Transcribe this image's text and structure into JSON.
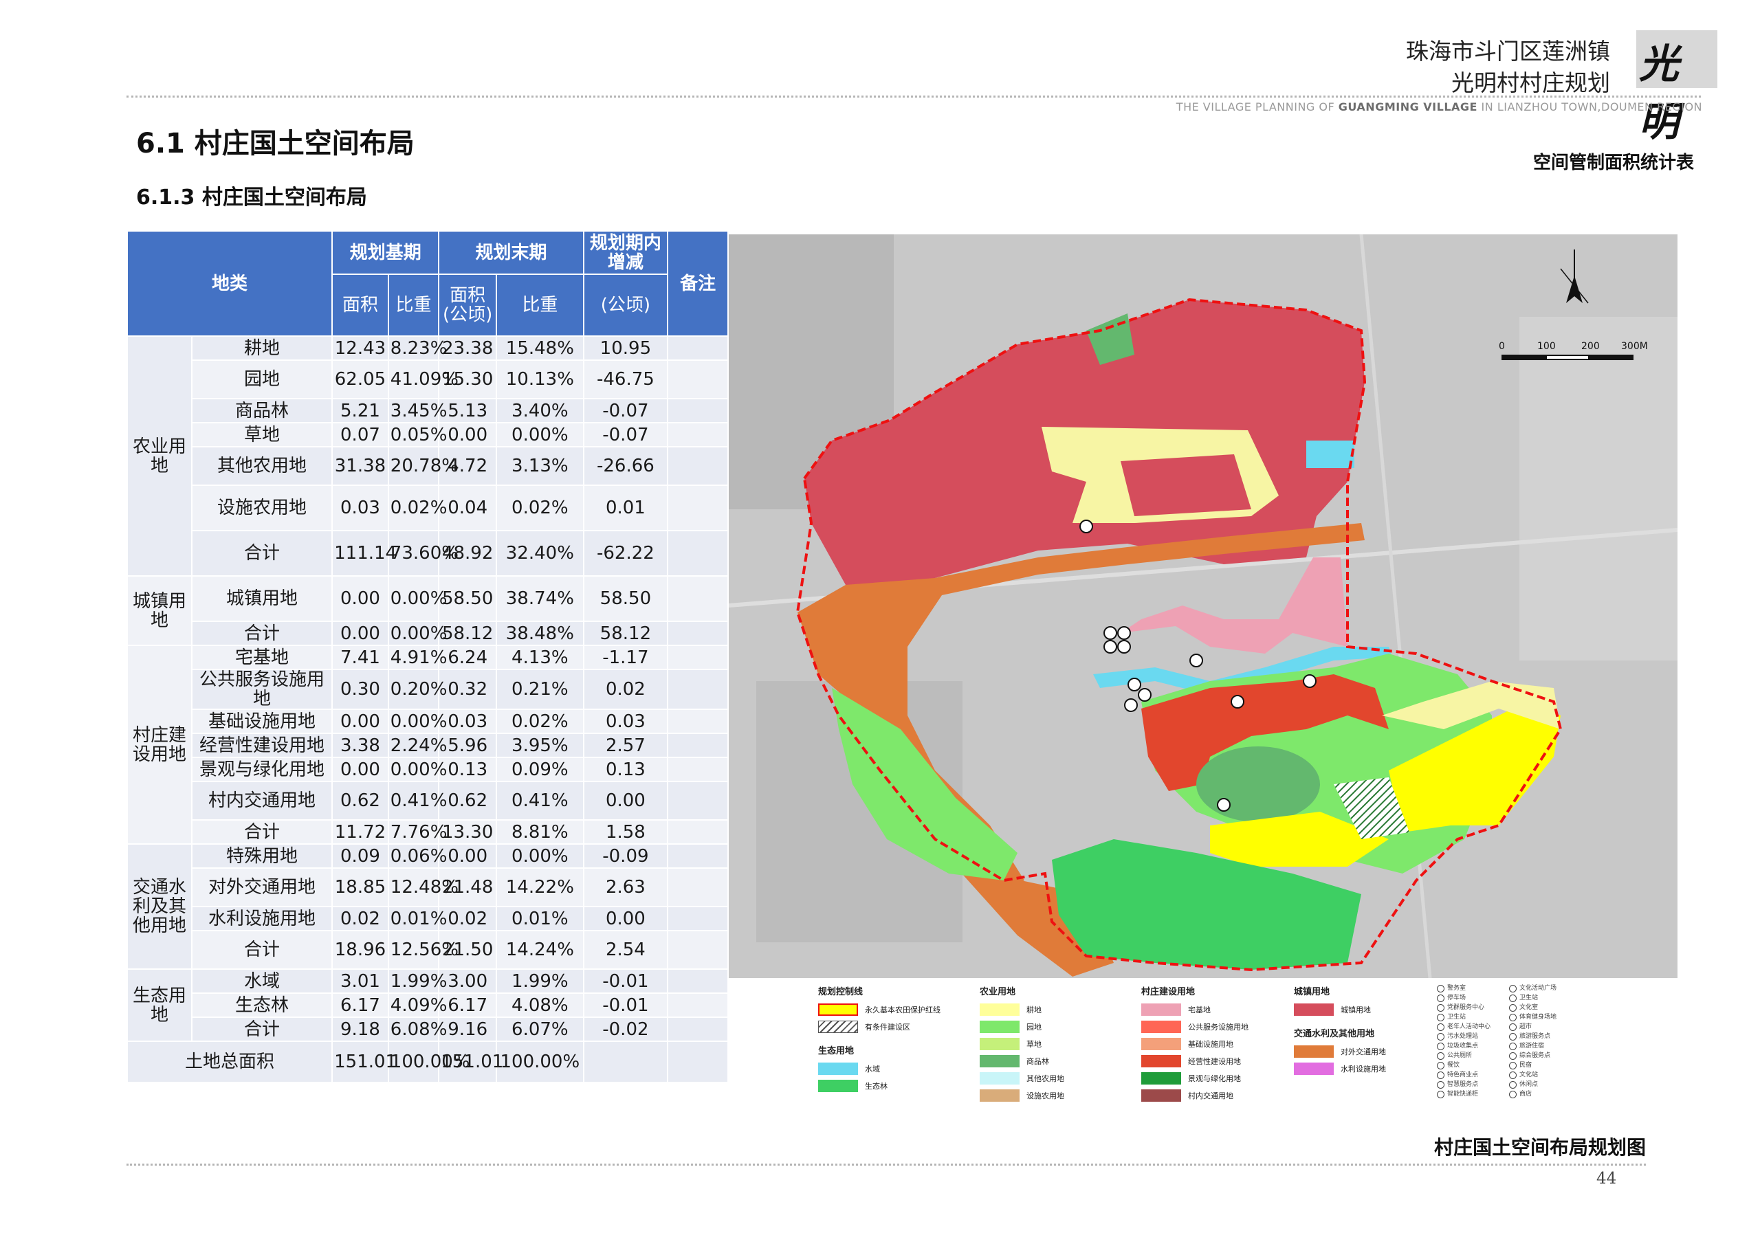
{
  "header": {
    "project_line1": "珠海市斗门区莲洲镇",
    "project_line2": "光明村村庄规划",
    "logo_text": "光明",
    "subtitle_pre": "THE VILLAGE PLANNING OF ",
    "subtitle_bold": "GUANGMING VILLAGE",
    "subtitle_post": " IN LIANZHOU TOWN,DOUMEN REGION"
  },
  "section_title": "6.1 村庄国土空间布局",
  "subsection_title": "6.1.3 村庄国土空间布局",
  "table_caption": "空间管制面积统计表",
  "map_caption": "村庄国土空间布局规划图",
  "page_number": "44",
  "table": {
    "headers": {
      "land_type": "地类",
      "base_period": "规划基期",
      "end_period": "规划末期",
      "change": "规划期内增减",
      "note": "备注",
      "area": "面积",
      "ratio": "比重",
      "area_ha": "面积(公顷)",
      "ratio2": "比重",
      "change_unit": "(公顷)"
    },
    "groups": {
      "agri": "农业用地",
      "urban": "城镇用地",
      "village": "村庄建设用地",
      "transport": "交通水利及其他用地",
      "eco": "生态用地"
    },
    "rows": [
      {
        "sub": "耕地",
        "a1": "12.43",
        "r1": "8.23%",
        "a2": "23.38",
        "r2": "15.48%",
        "d": "10.95"
      },
      {
        "sub": "园地",
        "a1": "62.05",
        "r1": "41.09%",
        "a2": "15.30",
        "r2": "10.13%",
        "d": "-46.75"
      },
      {
        "sub": "商品林",
        "a1": "5.21",
        "r1": "3.45%",
        "a2": "5.13",
        "r2": "3.40%",
        "d": "-0.07"
      },
      {
        "sub": "草地",
        "a1": "0.07",
        "r1": "0.05%",
        "a2": "0.00",
        "r2": "0.00%",
        "d": "-0.07"
      },
      {
        "sub": "其他农用地",
        "a1": "31.38",
        "r1": "20.78%",
        "a2": "4.72",
        "r2": "3.13%",
        "d": "-26.66"
      },
      {
        "sub": "设施农用地",
        "a1": "0.03",
        "r1": "0.02%",
        "a2": "0.04",
        "r2": "0.02%",
        "d": "0.01"
      },
      {
        "sub": "合计",
        "a1": "111.14",
        "r1": "73.60%",
        "a2": "48.92",
        "r2": "32.40%",
        "d": "-62.22"
      },
      {
        "sub": "城镇用地",
        "a1": "0.00",
        "r1": "0.00%",
        "a2": "58.50",
        "r2": "38.74%",
        "d": "58.50"
      },
      {
        "sub": "合计",
        "a1": "0.00",
        "r1": "0.00%",
        "a2": "58.12",
        "r2": "38.48%",
        "d": "58.12"
      },
      {
        "sub": "宅基地",
        "a1": "7.41",
        "r1": "4.91%",
        "a2": "6.24",
        "r2": "4.13%",
        "d": "-1.17"
      },
      {
        "sub": "公共服务设施用地",
        "a1": "0.30",
        "r1": "0.20%",
        "a2": "0.32",
        "r2": "0.21%",
        "d": "0.02"
      },
      {
        "sub": "基础设施用地",
        "a1": "0.00",
        "r1": "0.00%",
        "a2": "0.03",
        "r2": "0.02%",
        "d": "0.03"
      },
      {
        "sub": "经营性建设用地",
        "a1": "3.38",
        "r1": "2.24%",
        "a2": "5.96",
        "r2": "3.95%",
        "d": "2.57"
      },
      {
        "sub": "景观与绿化用地",
        "a1": "0.00",
        "r1": "0.00%",
        "a2": "0.13",
        "r2": "0.09%",
        "d": "0.13"
      },
      {
        "sub": "村内交通用地",
        "a1": "0.62",
        "r1": "0.41%",
        "a2": "0.62",
        "r2": "0.41%",
        "d": "0.00"
      },
      {
        "sub": "合计",
        "a1": "11.72",
        "r1": "7.76%",
        "a2": "13.30",
        "r2": "8.81%",
        "d": "1.58"
      },
      {
        "sub": "特殊用地",
        "a1": "0.09",
        "r1": "0.06%",
        "a2": "0.00",
        "r2": "0.00%",
        "d": "-0.09"
      },
      {
        "sub": "对外交通用地",
        "a1": "18.85",
        "r1": "12.48%",
        "a2": "21.48",
        "r2": "14.22%",
        "d": "2.63"
      },
      {
        "sub": "水利设施用地",
        "a1": "0.02",
        "r1": "0.01%",
        "a2": "0.02",
        "r2": "0.01%",
        "d": "0.00"
      },
      {
        "sub": "合计",
        "a1": "18.96",
        "r1": "12.56%",
        "a2": "21.50",
        "r2": "14.24%",
        "d": "2.54"
      },
      {
        "sub": "水域",
        "a1": "3.01",
        "r1": "1.99%",
        "a2": "3.00",
        "r2": "1.99%",
        "d": "-0.01"
      },
      {
        "sub": "生态林",
        "a1": "6.17",
        "r1": "4.09%",
        "a2": "6.17",
        "r2": "4.08%",
        "d": "-0.01"
      },
      {
        "sub": "合计",
        "a1": "9.18",
        "r1": "6.08%",
        "a2": "9.16",
        "r2": "6.07%",
        "d": "-0.02"
      }
    ],
    "total": {
      "label": "土地总面积",
      "a1": "151.01",
      "r1": "100.00%",
      "a2": "151.01",
      "r2": "100.00%"
    }
  },
  "map": {
    "scale_labels": [
      "0",
      "100",
      "200",
      "300M"
    ],
    "legend": {
      "control_head": "规划控制线",
      "control_items": [
        "永久基本农田保护红线",
        "有条件建设区"
      ],
      "eco_head": "生态用地",
      "eco_items": [
        "水域",
        "生态林"
      ],
      "agri_head": "农业用地",
      "agri_items": [
        "耕地",
        "园地",
        "草地",
        "商品林",
        "其他农用地",
        "设施农用地"
      ],
      "village_head": "村庄建设用地",
      "village_items": [
        "宅基地",
        "公共服务设施用地",
        "基础设施用地",
        "经营性建设用地",
        "景观与绿化用地",
        "村内交通用地"
      ],
      "urban_head": "城镇用地",
      "urban_items": [
        "城镇用地"
      ],
      "transport_head": "交通水利及其他用地",
      "transport_items": [
        "对外交通用地",
        "水利设施用地"
      ],
      "symbols_a": [
        "警务室",
        "停车场",
        "党群服务中心",
        "卫生站",
        "老年人活动中心",
        "污水处理站",
        "垃圾收集点",
        "公共厕所",
        "餐饮",
        "特色商业点",
        "智慧服务点",
        "智能快递柜"
      ],
      "symbols_b": [
        "文化活动广场",
        "卫生站",
        "文化室",
        "体育健身场地",
        "超市",
        "旅游服务点",
        "旅游住宿",
        "综合服务点",
        "民宿",
        "文化站",
        "休闲点",
        "商店"
      ]
    },
    "colors": {
      "urban": "#d54d5c",
      "highway": "#e07b39",
      "cultivated": "#ffff00",
      "garden": "#7ee86b",
      "grass": "#c5f07a",
      "forest_commercial": "#63b86e",
      "other_agri": "#f7f5a4",
      "facility_agri": "#d9ac7a",
      "homestead": "#eea1b4",
      "public_service": "#ff6655",
      "infrastructure": "#f4a07a",
      "commercial": "#e2462d",
      "landscape": "#1f9c3a",
      "village_road": "#9c4a4a",
      "water": "#6ad9f0",
      "eco_forest": "#3ecf63",
      "water_facility": "#e26de0",
      "header_blue": "#4472c4"
    }
  }
}
